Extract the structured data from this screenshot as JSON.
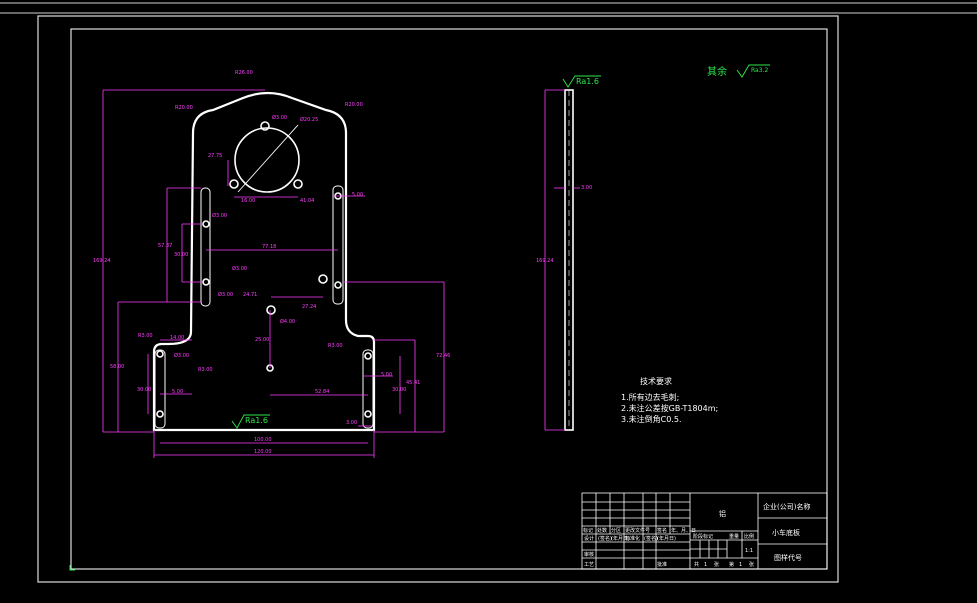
{
  "drawing": {
    "dims_front": {
      "r_top": "R26.00",
      "r_tl": "R20.00",
      "r_tr": "R20.00",
      "d_small_top": "Ø3.00",
      "d_big": "Ø20.25",
      "h_center": "27.75",
      "x_left_hole": "16.00",
      "x_right_hole": "41.04",
      "slot_w": "5.00",
      "slot_hole": "Ø3.00",
      "h_slot_outer": "57.37",
      "h_slot_inner": "30.00",
      "w_slots": "77.18",
      "d_mid1": "Ø3.00",
      "d_mid2": "Ø3.00",
      "x_a": "24.71",
      "x_b": "27.24",
      "d_mid3": "Ø4.00",
      "h_total": "169.24",
      "h_low": "58.00",
      "r_step_l": "R3.00",
      "w_step": "14.00",
      "d_low1": "Ø3.00",
      "r_low": "R3.00",
      "h_low_slot": "30.00",
      "w_slot2": "5.00",
      "h_mid": "25.00",
      "r_step_r": "R3.00",
      "h_right": "72.46",
      "w_slot_r": "5.00",
      "h_r2": "45.41",
      "h_r3": "30.00",
      "w_r": "52.84",
      "w_small": "3.00",
      "w_inner": "100.00",
      "w_total": "120.00"
    },
    "side": {
      "roughness": "Ra1.6",
      "height": "169.24",
      "thickness": "3.00"
    },
    "roughness_front": "Ra1.6",
    "other": {
      "label": "其余",
      "value": "Ra3.2"
    },
    "notes": {
      "title": "技术要求",
      "items": [
        "1.所有边去毛刺;",
        "2.未注公差按GB-T1804m;",
        "3.未注倒角C0.5."
      ]
    }
  },
  "title_block": {
    "material": "铝",
    "company": "企业(公司)名称",
    "part_name": "小车底板",
    "drawing_no_label": "图样代号",
    "scale": "1:1",
    "rev_cols": [
      "标记",
      "处数",
      "分区",
      "更改文件号",
      "签名",
      "年、月、日"
    ],
    "row_labels": [
      "设计",
      "审核",
      "工艺"
    ],
    "sign_cells": [
      "(签名)",
      "(年月日)",
      "标准化",
      "(签名)",
      "(年月日)"
    ],
    "stage_label": "阶段标记",
    "weight_label": "重量",
    "scale_label": "比例",
    "approve_label": "批准",
    "sheet_cells": [
      "共",
      "1",
      "张",
      "第",
      "1",
      "张"
    ]
  }
}
